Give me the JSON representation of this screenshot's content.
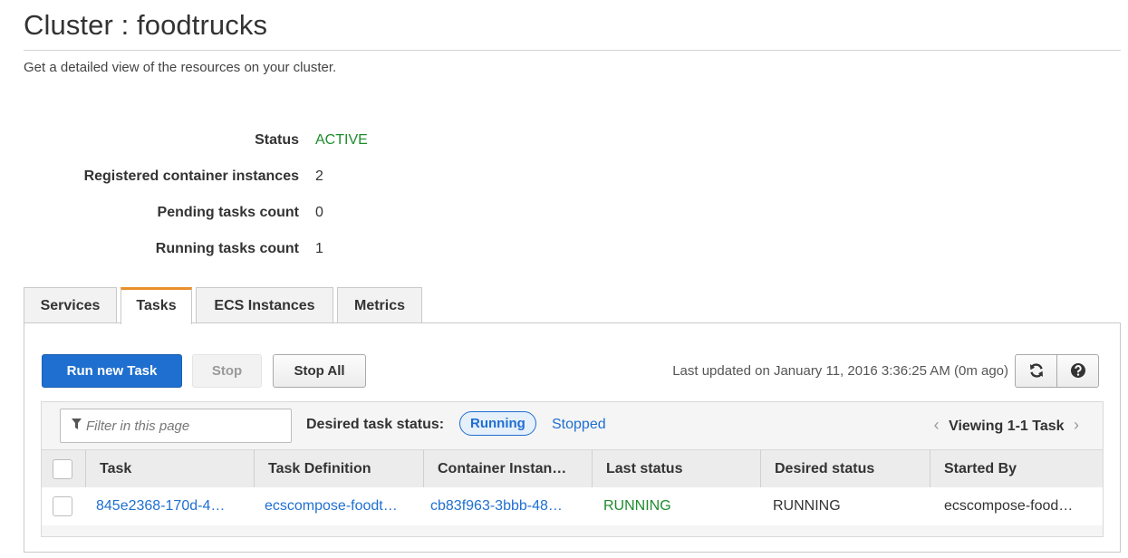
{
  "header": {
    "title": "Cluster : foodtrucks",
    "subtitle": "Get a detailed view of the resources on your cluster."
  },
  "summary": [
    {
      "label": "Status",
      "value": "ACTIVE"
    },
    {
      "label": "Registered container instances",
      "value": "2"
    },
    {
      "label": "Pending tasks count",
      "value": "0"
    },
    {
      "label": "Running tasks count",
      "value": "1"
    }
  ],
  "tabs": [
    {
      "label": "Services"
    },
    {
      "label": "Tasks"
    },
    {
      "label": "ECS Instances"
    },
    {
      "label": "Metrics"
    }
  ],
  "toolbar": {
    "run_label": "Run new Task",
    "stop_label": "Stop",
    "stop_all_label": "Stop All",
    "last_updated": "Last updated on January 11, 2016 3:36:25 AM (0m ago)",
    "refresh_icon": "refresh-icon",
    "help_icon": "help-icon"
  },
  "filter": {
    "placeholder": "Filter in this page",
    "desired_label": "Desired task status:",
    "running_label": "Running",
    "stopped_label": "Stopped",
    "viewing": "Viewing 1-1 Task"
  },
  "table": {
    "columns": [
      "Task",
      "Task Definition",
      "Container Instan…",
      "Last status",
      "Desired status",
      "Started By"
    ],
    "rows": [
      [
        "845e2368-170d-4…",
        "ecscompose-foodt…",
        "cb83f963-3bbb-48…",
        "RUNNING",
        "RUNNING",
        "ecscompose-food…"
      ]
    ]
  },
  "colors": {
    "accent": "#1f6fd0",
    "active_status": "#1e8c2e",
    "active_tab": "#e98f2b"
  }
}
